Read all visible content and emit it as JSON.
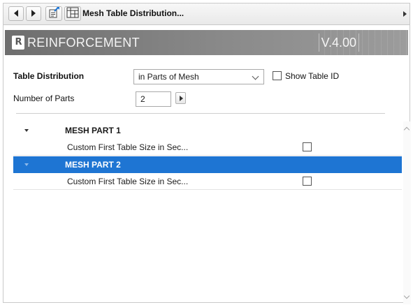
{
  "toolbar": {
    "title": "Mesh Table Distribution...",
    "icons": [
      "back-arrow-icon",
      "forward-arrow-icon",
      "edit-icon",
      "mesh-table-icon",
      "expand-arrow-icon"
    ]
  },
  "banner": {
    "logo": "R",
    "title": "REINFORCEMENT",
    "version": "V.4.00"
  },
  "form": {
    "table_distribution_label": "Table Distribution",
    "table_distribution_value": "in Parts of Mesh",
    "show_table_id_label": "Show Table ID",
    "show_table_id_checked": false,
    "number_of_parts_label": "Number of Parts",
    "number_of_parts_value": "2"
  },
  "list": {
    "groups": [
      {
        "label": "MESH PART 1",
        "expanded": true,
        "selected": false,
        "items": [
          {
            "label": "Custom First Table Size in Sec...",
            "checked": false
          }
        ]
      },
      {
        "label": "MESH PART 2",
        "expanded": true,
        "selected": true,
        "items": [
          {
            "label": "Custom First Table Size in Sec...",
            "checked": false
          }
        ]
      }
    ]
  },
  "colors": {
    "selection": "#1e75d3",
    "banner": "#7d7d7d"
  }
}
